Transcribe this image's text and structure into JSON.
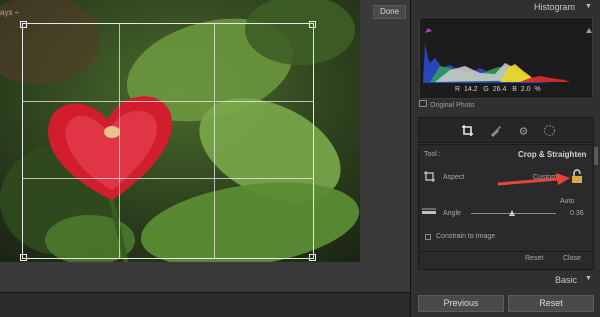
{
  "histogram": {
    "title": "Histogram",
    "r_label": "R",
    "r_value": "14.2",
    "g_label": "G",
    "g_value": "26.4",
    "b_label": "B",
    "b_value": "2.0",
    "pct": "%",
    "original_photo": "Original Photo"
  },
  "crop": {
    "tool_label": "Tool :",
    "tool_name": "Crop & Straighten",
    "aspect_label": "Aspect",
    "aspect_value": "Custom",
    "auto_label": "Auto",
    "angle_label": "Angle",
    "angle_value": "0.36",
    "constrain_label": "Constrain to Image",
    "reset_label": "Reset",
    "close_label": "Close"
  },
  "basic": {
    "title": "Basic"
  },
  "buttons": {
    "previous": "Previous",
    "reset": "Reset"
  },
  "toolbar": {
    "ways_text": "ays ÷",
    "done_label": "Done"
  },
  "icons": [
    "crop-icon",
    "brush-icon",
    "eye-icon",
    "circle-icon",
    "lock-icon",
    "straighten-icon",
    "level-icon",
    "red-arrow-icon"
  ],
  "colors": {
    "panel": "#303030",
    "histogram_bg": "#1c1c1c",
    "annotation_arrow": "#e8453a"
  }
}
